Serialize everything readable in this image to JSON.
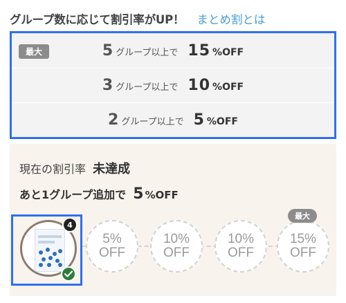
{
  "header": {
    "title": "グループ数に応じて割引率がUP！",
    "link": "まとめ割とは"
  },
  "tiers": {
    "max_badge": "最大",
    "items": [
      {
        "count": "5",
        "unit": "グループ以上で",
        "rate": "15",
        "off": "%OFF"
      },
      {
        "count": "3",
        "unit": "グループ以上で",
        "rate": "10",
        "off": "%OFF"
      },
      {
        "count": "2",
        "unit": "グループ以上で",
        "rate": "5",
        "off": "%OFF"
      }
    ]
  },
  "status": {
    "current_label": "現在の割引率",
    "current_value": "未達成",
    "next_label": "あと1グループ追加で",
    "next_rate": "5",
    "next_off": "%OFF"
  },
  "progress": {
    "product_qty": "4",
    "steps": [
      {
        "rate": "5%",
        "off": "OFF"
      },
      {
        "rate": "10%",
        "off": "OFF"
      },
      {
        "rate": "10%",
        "off": "OFF"
      },
      {
        "rate": "15%",
        "off": "OFF"
      }
    ],
    "max_tag": "最大"
  },
  "colors": {
    "link": "#4a9fd8",
    "highlight_border": "#2f6ff0",
    "badge_gray": "#8c8c8c",
    "status_bg": "#f8f3ec",
    "check_green": "#2f7d3b"
  }
}
